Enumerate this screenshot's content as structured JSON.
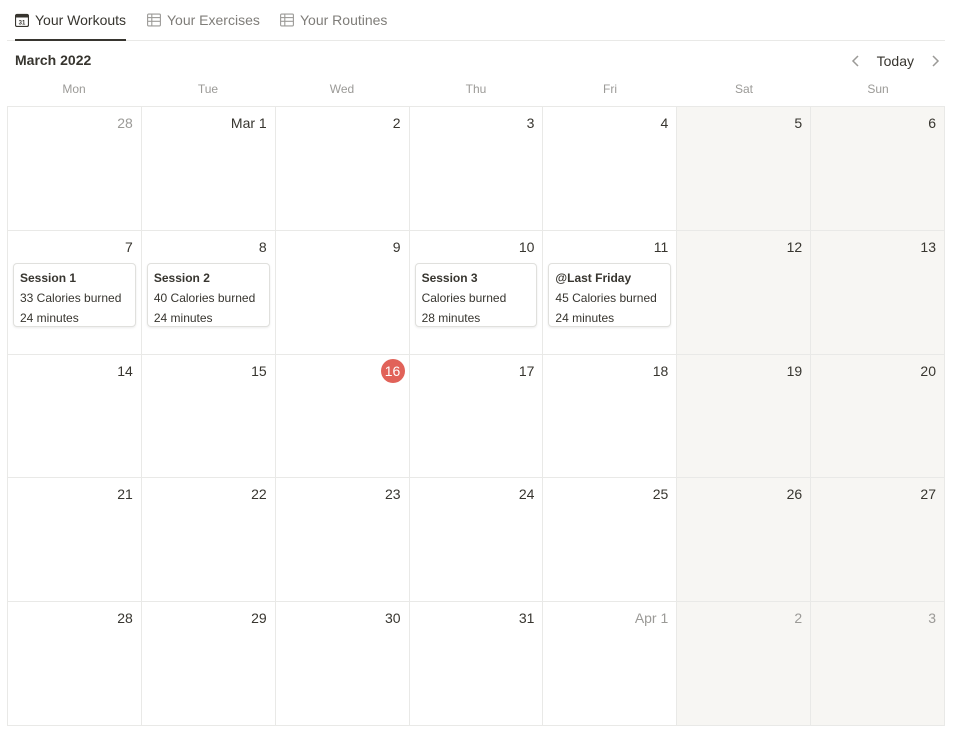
{
  "tabs": [
    {
      "label": "Your Workouts",
      "icon": "calendar-icon",
      "active": true
    },
    {
      "label": "Your Exercises",
      "icon": "table-icon",
      "active": false
    },
    {
      "label": "Your Routines",
      "icon": "table-icon",
      "active": false
    }
  ],
  "calendar": {
    "title": "March 2022",
    "today_label": "Today",
    "day_names": [
      "Mon",
      "Tue",
      "Wed",
      "Thu",
      "Fri",
      "Sat",
      "Sun"
    ],
    "weeks": [
      [
        {
          "date": "28",
          "muted": true
        },
        {
          "date": "Mar 1"
        },
        {
          "date": "2"
        },
        {
          "date": "3"
        },
        {
          "date": "4"
        },
        {
          "date": "5",
          "weekend": true
        },
        {
          "date": "6",
          "weekend": true
        }
      ],
      [
        {
          "date": "7",
          "event": {
            "title": "Session 1",
            "calories": "33 Calories burned",
            "duration": "24 minutes"
          }
        },
        {
          "date": "8",
          "event": {
            "title": "Session 2",
            "calories": "40 Calories burned",
            "duration": "24 minutes"
          }
        },
        {
          "date": "9"
        },
        {
          "date": "10",
          "event": {
            "title": "Session 3",
            "calories": "Calories burned",
            "duration": "28 minutes"
          }
        },
        {
          "date": "11",
          "event": {
            "title": "@Last Friday",
            "calories": "45 Calories burned",
            "duration": "24 minutes"
          }
        },
        {
          "date": "12",
          "weekend": true
        },
        {
          "date": "13",
          "weekend": true
        }
      ],
      [
        {
          "date": "14"
        },
        {
          "date": "15"
        },
        {
          "date": "16",
          "today": true
        },
        {
          "date": "17"
        },
        {
          "date": "18"
        },
        {
          "date": "19",
          "weekend": true
        },
        {
          "date": "20",
          "weekend": true
        }
      ],
      [
        {
          "date": "21"
        },
        {
          "date": "22"
        },
        {
          "date": "23"
        },
        {
          "date": "24"
        },
        {
          "date": "25"
        },
        {
          "date": "26",
          "weekend": true
        },
        {
          "date": "27",
          "weekend": true
        }
      ],
      [
        {
          "date": "28"
        },
        {
          "date": "29"
        },
        {
          "date": "30"
        },
        {
          "date": "31"
        },
        {
          "date": "Apr 1",
          "muted": true
        },
        {
          "date": "2",
          "muted": true,
          "weekend": true
        },
        {
          "date": "3",
          "muted": true,
          "weekend": true
        }
      ]
    ]
  },
  "colors": {
    "today_badge": "#e16259",
    "weekend_bg": "#f7f6f3",
    "border": "#e9e9e7",
    "text": "#37352f",
    "muted": "#9b9a97"
  }
}
